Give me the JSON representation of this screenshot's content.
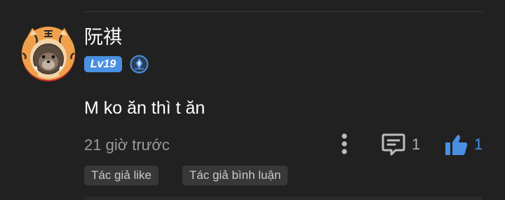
{
  "comment": {
    "username": "阮祺",
    "level": "Lv19",
    "text": "M ko ăn thì t ăn",
    "timestamp": "21 giờ trước",
    "reply_count": "1",
    "like_count": "1",
    "tags": [
      "Tác giả like",
      "Tác giả bình luận"
    ]
  },
  "icons": {
    "avatar": "tiger-hat-avatar",
    "verified": "verified-badge-icon",
    "more": "more-vertical-icon",
    "comment": "comment-icon",
    "like": "thumbs-up-icon"
  },
  "colors": {
    "background": "#212121",
    "accent": "#4a90e2",
    "muted_text": "#9a9a9a",
    "tag_bg": "#383838"
  }
}
